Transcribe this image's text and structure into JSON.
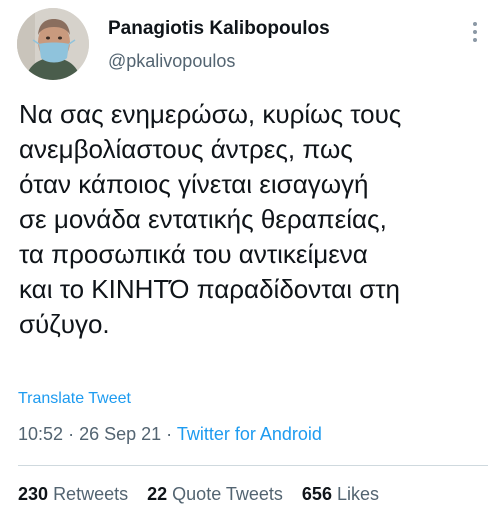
{
  "author": {
    "name": "Panagiotis Kalibopoulos",
    "handle": "@pkalivopoulos",
    "avatar_icon": "profile-photo-masked-man"
  },
  "more_icon": "vertical-ellipsis-icon",
  "tweet": {
    "text": "Να σας ενημερώσω, κυρίως τους\nανεμβολίαστους άντρες, πως\nόταν κάποιος γίνεται εισαγωγή\nσε μονάδα εντατικής θεραπείας,\nτα προσωπικά του αντικείμενα\nκαι το ΚΙΝΗΤΌ παραδίδονται στη\nσύζυγο."
  },
  "translate_label": "Translate Tweet",
  "meta": {
    "time": "10:52",
    "separator": "·",
    "date": "26 Sep 21",
    "source": "Twitter for Android"
  },
  "stats": {
    "retweets_count": "230",
    "retweets_label": "Retweets",
    "quotes_count": "22",
    "quotes_label": "Quote Tweets",
    "likes_count": "656",
    "likes_label": "Likes"
  },
  "colors": {
    "link": "#1d9bf0",
    "secondary_text": "#536471",
    "primary_text": "#0f1419"
  }
}
